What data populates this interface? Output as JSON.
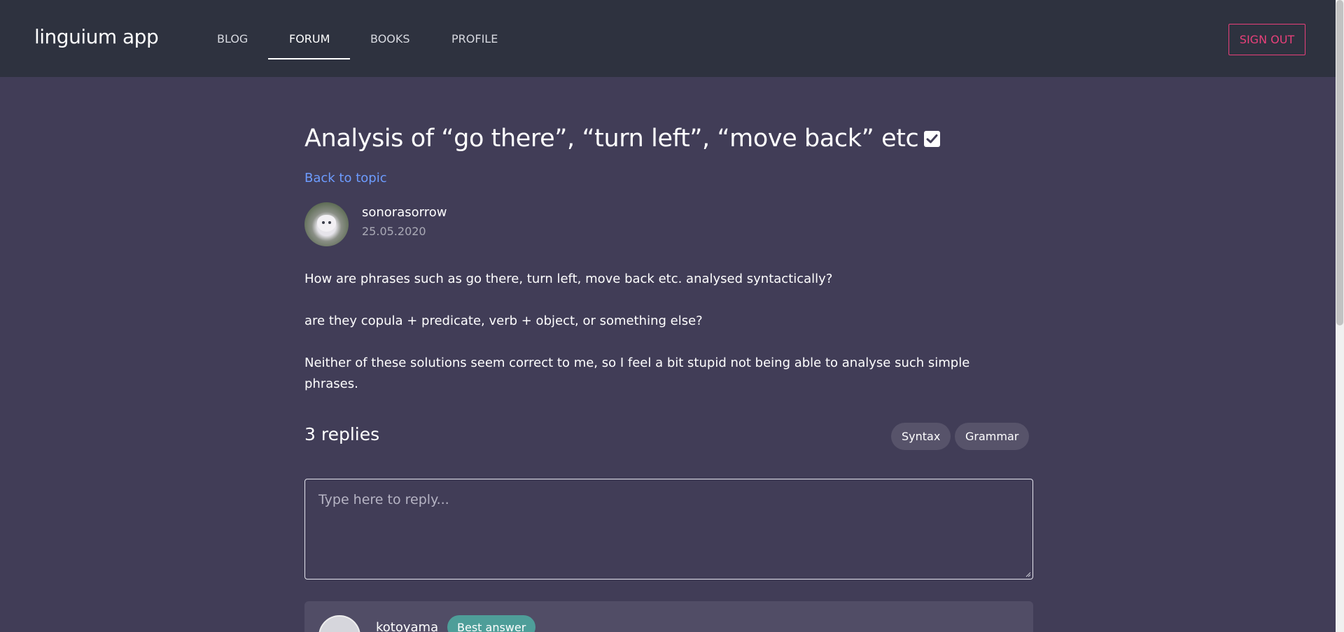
{
  "nav": {
    "brand": "linguium app",
    "items": [
      {
        "label": "BLOG"
      },
      {
        "label": "FORUM"
      },
      {
        "label": "BOOKS"
      },
      {
        "label": "PROFILE"
      }
    ],
    "active": "FORUM",
    "signout_label": "SIGN OUT"
  },
  "post": {
    "title": "Analysis of “go there”, “turn left”, “move back” etc",
    "back_label": "Back to topic",
    "author": "sonorasorrow",
    "date": "25.05.2020",
    "paragraphs": [
      "How are phrases such as go there, turn left, move back etc. analysed syntactically?",
      "are they copula + predicate, verb + object, or something else?",
      "Neither of these solutions seem correct to me, so I feel a bit stupid not being able to analyse such simple phrases."
    ]
  },
  "replies": {
    "count_label": "3 replies",
    "tags": [
      {
        "label": "Syntax"
      },
      {
        "label": "Grammar"
      }
    ],
    "input_placeholder": "Type here to reply...",
    "first_reply": {
      "author": "kotoyama",
      "badge": "Best answer"
    }
  },
  "colors": {
    "navbar_bg": "#2e323f",
    "page_bg": "#413d57",
    "accent_link": "#6d9cff",
    "signout": "#e8407a",
    "badge": "#4e9e99",
    "tag_bg": "#57536a"
  }
}
